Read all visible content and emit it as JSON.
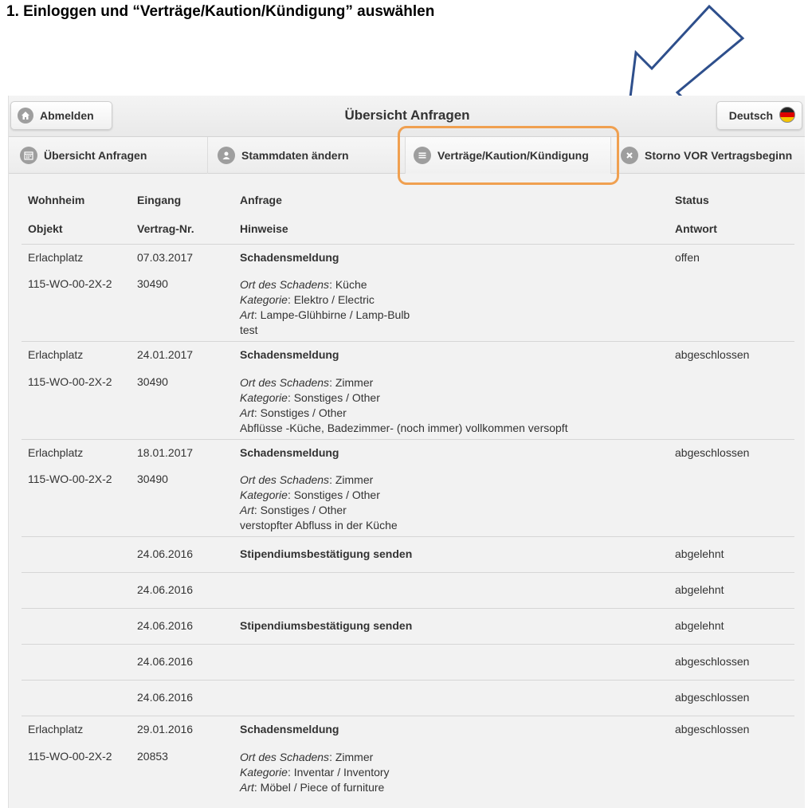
{
  "instruction": "1. Einloggen und “Verträge/Kaution/Kündigung” auswählen",
  "header": {
    "logout_label": "Abmelden",
    "title": "Übersicht Anfragen",
    "language_label": "Deutsch"
  },
  "nav": {
    "overview": "Übersicht Anfragen",
    "master_data": "Stammdaten ändern",
    "contracts": "Verträge/Kaution/Kündigung",
    "storno": "Storno VOR Vertragsbeginn"
  },
  "columns": {
    "h1": [
      "Wohnheim",
      "Eingang",
      "Anfrage",
      "Status"
    ],
    "h2": [
      "Objekt",
      "Vertrag-Nr.",
      "Hinweise",
      "Antwort"
    ]
  },
  "labels": {
    "ort": "Ort des Schadens",
    "kategorie": "Kategorie",
    "art": "Art"
  },
  "rows": [
    {
      "wohnheim": "Erlachplatz",
      "date": "07.03.2017",
      "request": "Schadensmeldung",
      "status": "offen",
      "objekt": "115-WO-00-2X-2",
      "vertrag": "30490",
      "ort": "Küche",
      "kategorie": "Elektro / Electric",
      "art": "Lampe-Glühbirne / Lamp-Bulb",
      "note": "test"
    },
    {
      "wohnheim": "Erlachplatz",
      "date": "24.01.2017",
      "request": "Schadensmeldung",
      "status": "abgeschlossen",
      "objekt": "115-WO-00-2X-2",
      "vertrag": "30490",
      "ort": "Zimmer",
      "kategorie": "Sonstiges / Other",
      "art": "Sonstiges / Other",
      "note": "Abflüsse -Küche, Badezimmer- (noch immer) vollkommen versopft"
    },
    {
      "wohnheim": "Erlachplatz",
      "date": "18.01.2017",
      "request": "Schadensmeldung",
      "status": "abgeschlossen",
      "objekt": "115-WO-00-2X-2",
      "vertrag": "30490",
      "ort": "Zimmer",
      "kategorie": "Sonstiges / Other",
      "art": "Sonstiges / Other",
      "note": "verstopfter Abfluss in der Küche"
    },
    {
      "date": "24.06.2016",
      "request": "Stipendiumsbestätigung senden",
      "status": "abgelehnt"
    },
    {
      "date": "24.06.2016",
      "request": "",
      "status": "abgelehnt"
    },
    {
      "date": "24.06.2016",
      "request": "Stipendiumsbestätigung senden",
      "status": "abgelehnt"
    },
    {
      "date": "24.06.2016",
      "request": "",
      "status": "abgeschlossen"
    },
    {
      "date": "24.06.2016",
      "request": "",
      "status": "abgeschlossen"
    },
    {
      "wohnheim": "Erlachplatz",
      "date": "29.01.2016",
      "request": "Schadensmeldung",
      "status": "abgeschlossen",
      "objekt": "115-WO-00-2X-2",
      "vertrag": "20853",
      "ort": "Zimmer",
      "kategorie": "Inventar / Inventory",
      "art": "Möbel / Piece of furniture"
    }
  ],
  "colors": {
    "highlight": "#f0a050",
    "arrow": "#2e4f8c"
  }
}
